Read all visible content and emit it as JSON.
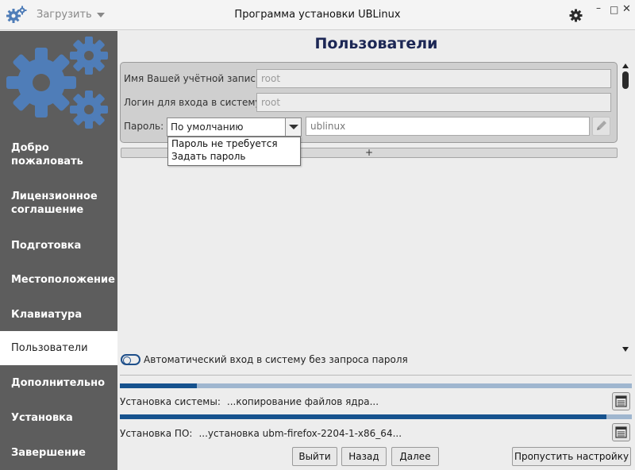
{
  "titlebar": {
    "load_menu_label": "Загрузить",
    "title": "Программа установки UBLinux",
    "minimize_glyph": "–",
    "maximize_glyph": "□",
    "close_glyph": "✕"
  },
  "sidebar": {
    "items": [
      {
        "label": "Добро пожаловать",
        "active": false
      },
      {
        "label": "Лицензионное соглашение",
        "active": false
      },
      {
        "label": "Подготовка",
        "active": false
      },
      {
        "label": "Местоположение",
        "active": false
      },
      {
        "label": "Клавиатура",
        "active": false
      },
      {
        "label": "Пользователи",
        "active": true
      },
      {
        "label": "Дополнительно",
        "active": false
      },
      {
        "label": "Установка",
        "active": false
      },
      {
        "label": "Завершение",
        "active": false
      }
    ]
  },
  "main": {
    "title": "Пользователи",
    "account_label": "Имя Вашей учётной записи:",
    "account_value": "root",
    "login_label": "Логин для входа в систему:",
    "login_value": "root",
    "password_label": "Пароль:",
    "password_mode": "По умолчанию",
    "password_value": "ublinux",
    "password_options": [
      "Пароль не требуется",
      "Задать пароль"
    ],
    "add_user_label": "+",
    "autologin_label": "Автоматический вход в систему без запроса пароля"
  },
  "status": {
    "system_label": "Установка системы:",
    "system_value": "...копирование файлов ядра...",
    "system_progress": 0.15,
    "software_label": "Установка ПО:",
    "software_value": "...установка ubm-firefox-2204-1-x86_64...",
    "software_progress": 0.95
  },
  "buttons": {
    "exit": "Выйти",
    "back": "Назад",
    "next": "Далее",
    "skip": "Пропустить настройку"
  },
  "colors": {
    "sidebar_bg": "#5d5d5d",
    "accent_blue": "#16528e",
    "progress_track": "#9fb6cf",
    "logo_blue": "#4f7db8"
  },
  "icons": {
    "app": "gears-icon",
    "settings": "gear-icon",
    "edit": "pencil-icon",
    "log": "log-icon"
  }
}
